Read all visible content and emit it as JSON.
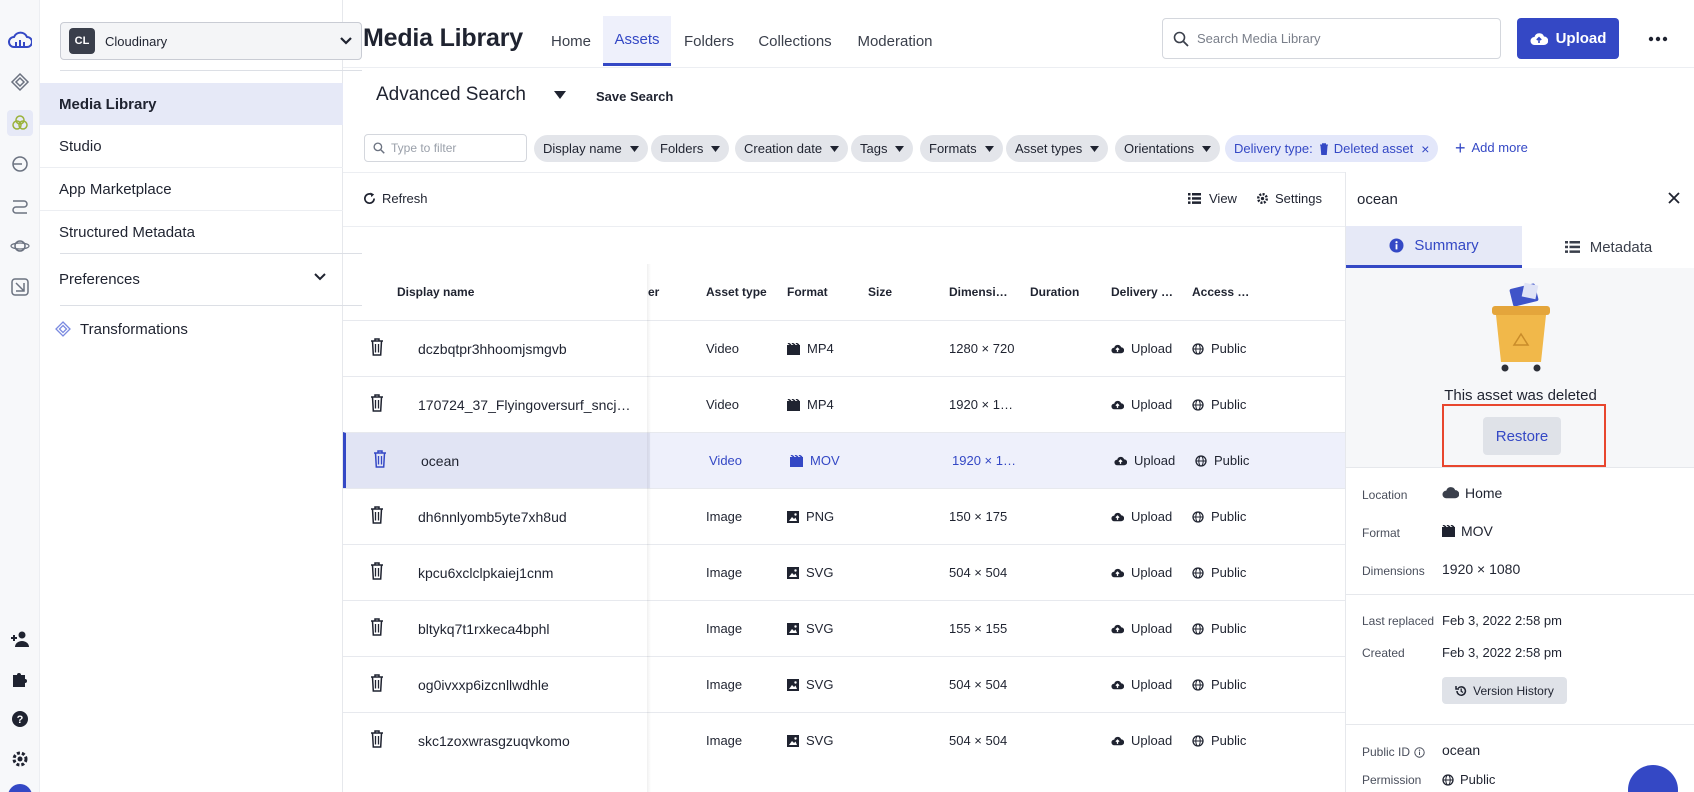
{
  "sidebar": {
    "cloud_badge": "CL",
    "cloud_name": "Cloudinary",
    "items": [
      {
        "label": "Media Library"
      },
      {
        "label": "Studio"
      },
      {
        "label": "App Marketplace"
      },
      {
        "label": "Structured Metadata"
      },
      {
        "label": "Preferences"
      },
      {
        "label": "Transformations"
      }
    ]
  },
  "header": {
    "title": "Media Library",
    "tabs": [
      {
        "label": "Home"
      },
      {
        "label": "Assets"
      },
      {
        "label": "Folders"
      },
      {
        "label": "Collections"
      },
      {
        "label": "Moderation"
      }
    ],
    "search_placeholder": "Search Media Library",
    "upload_label": "Upload"
  },
  "search": {
    "title": "Advanced Search",
    "save_label": "Save Search",
    "filter_placeholder": "Type to filter",
    "chips": [
      {
        "label": "Display name"
      },
      {
        "label": "Folders"
      },
      {
        "label": "Creation date"
      },
      {
        "label": "Tags"
      },
      {
        "label": "Formats"
      },
      {
        "label": "Asset types"
      },
      {
        "label": "Orientations"
      }
    ],
    "delivery_chip": {
      "label": "Delivery type:",
      "value": "Deleted asset",
      "close": "×"
    },
    "add_more": "Add more"
  },
  "toolbar": {
    "refresh": "Refresh",
    "view": "View",
    "settings": "Settings"
  },
  "table": {
    "columns": {
      "display_name": "Display name",
      "partial": "er",
      "asset_type": "Asset type",
      "format": "Format",
      "size": "Size",
      "dimensions": "Dimensi…",
      "duration": "Duration",
      "delivery": "Delivery …",
      "access": "Access …"
    },
    "rows": [
      {
        "name": "dczbqtpr3hhoomjsmgvb",
        "type": "Video",
        "format": "MP4",
        "icon": "film-icon",
        "size": "",
        "dims": "1280 × 720",
        "duration": "",
        "delivery": "Upload",
        "access": "Public"
      },
      {
        "name": "170724_37_Flyingoversurf_sncj…",
        "type": "Video",
        "format": "MP4",
        "icon": "film-icon",
        "size": "",
        "dims": "1920 × 1…",
        "duration": "",
        "delivery": "Upload",
        "access": "Public"
      },
      {
        "name": "ocean",
        "type": "Video",
        "format": "MOV",
        "icon": "film-icon",
        "size": "",
        "dims": "1920 × 1…",
        "duration": "",
        "delivery": "Upload",
        "access": "Public"
      },
      {
        "name": "dh6nnlyomb5yte7xh8ud",
        "type": "Image",
        "format": "PNG",
        "icon": "image-icon",
        "size": "",
        "dims": "150 × 175",
        "duration": "",
        "delivery": "Upload",
        "access": "Public"
      },
      {
        "name": "kpcu6xclclpkaiej1cnm",
        "type": "Image",
        "format": "SVG",
        "icon": "image-icon",
        "size": "",
        "dims": "504 × 504",
        "duration": "",
        "delivery": "Upload",
        "access": "Public"
      },
      {
        "name": "bltykq7t1rxkeca4bphl",
        "type": "Image",
        "format": "SVG",
        "icon": "image-icon",
        "size": "",
        "dims": "155 × 155",
        "duration": "",
        "delivery": "Upload",
        "access": "Public"
      },
      {
        "name": "og0ivxxp6izcnllwdhle",
        "type": "Image",
        "format": "SVG",
        "icon": "image-icon",
        "size": "",
        "dims": "504 × 504",
        "duration": "",
        "delivery": "Upload",
        "access": "Public"
      },
      {
        "name": "skc1zoxwrasgzuqvkomo",
        "type": "Image",
        "format": "SVG",
        "icon": "image-icon",
        "size": "",
        "dims": "504 × 504",
        "duration": "",
        "delivery": "Upload",
        "access": "Public"
      }
    ],
    "selected_row": "ocean"
  },
  "details": {
    "title": "ocean",
    "tabs": [
      {
        "label": "Summary"
      },
      {
        "label": "Metadata"
      }
    ],
    "deleted_message": "This asset was deleted",
    "restore_label": "Restore",
    "fields": [
      {
        "label": "Location",
        "value": "Home",
        "icon": "cloud-icon"
      },
      {
        "label": "Format",
        "value": "MOV",
        "icon": "film-icon"
      },
      {
        "label": "Dimensions",
        "value": "1920 × 1080"
      },
      {
        "label": "Last replaced",
        "value": "Feb 3, 2022 2:58 pm"
      },
      {
        "label": "Created",
        "value": "Feb 3, 2022 2:58 pm"
      },
      {
        "label": "Public ID",
        "value": "ocean"
      },
      {
        "label": "Permission",
        "value": "Public"
      }
    ],
    "version_history_label": "Version History"
  },
  "colors": {
    "accent": "#3448c5",
    "highlight_frame": "#e8462e"
  }
}
